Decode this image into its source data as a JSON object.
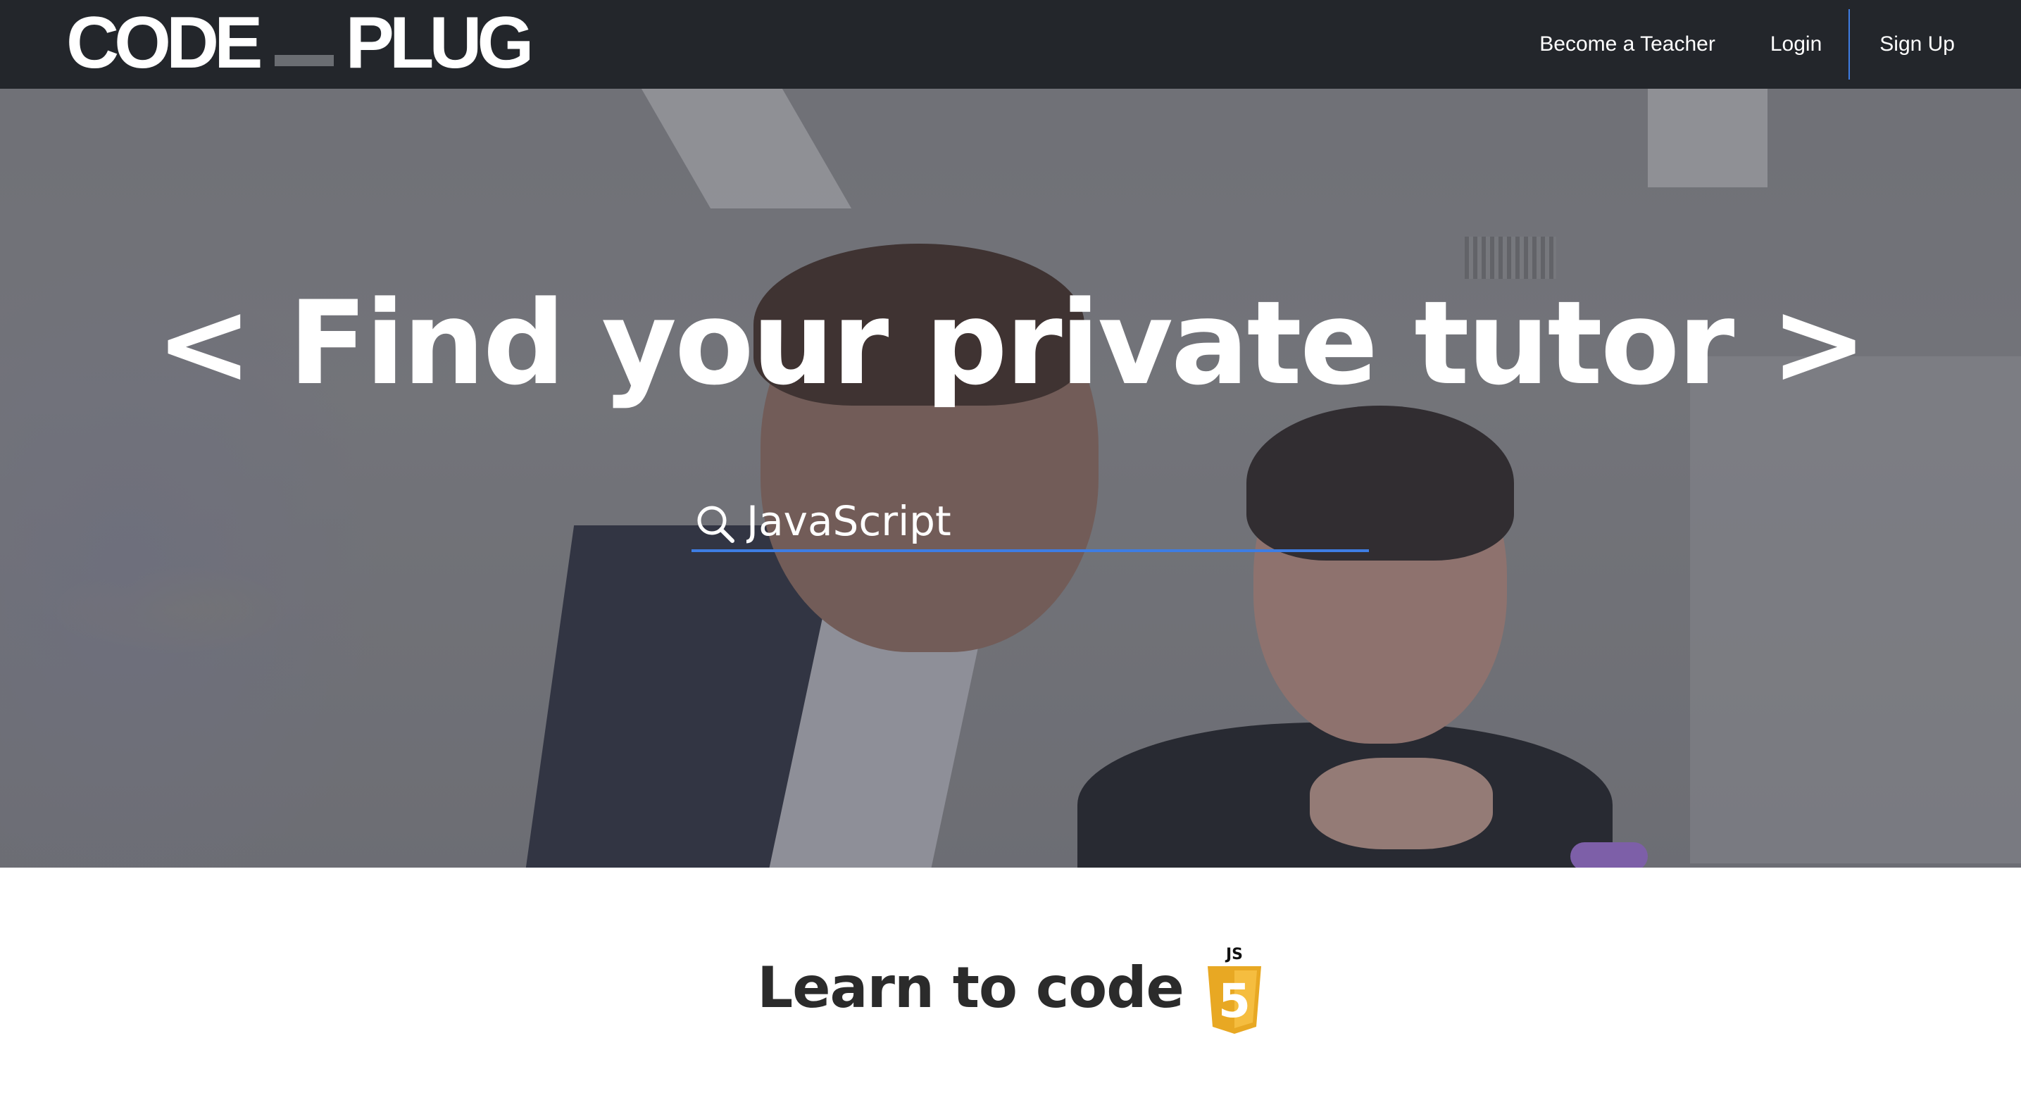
{
  "nav": {
    "logo_left": "CODE",
    "logo_right": "PLUG",
    "links": [
      {
        "label": "Become a Teacher"
      },
      {
        "label": "Login"
      },
      {
        "label": "Sign Up"
      }
    ],
    "separator_color": "#3e7de3",
    "background": "#23262b"
  },
  "hero": {
    "title": "< Find your private tutor >",
    "search": {
      "value": "JavaScript",
      "icon": "search-icon",
      "underline_color": "#3e7de3"
    }
  },
  "learn": {
    "title": "Learn to code",
    "badge_top": "JS",
    "badge_number": "5",
    "badge_icon": "javascript-logo-icon",
    "badge_color": "#f0b131"
  }
}
